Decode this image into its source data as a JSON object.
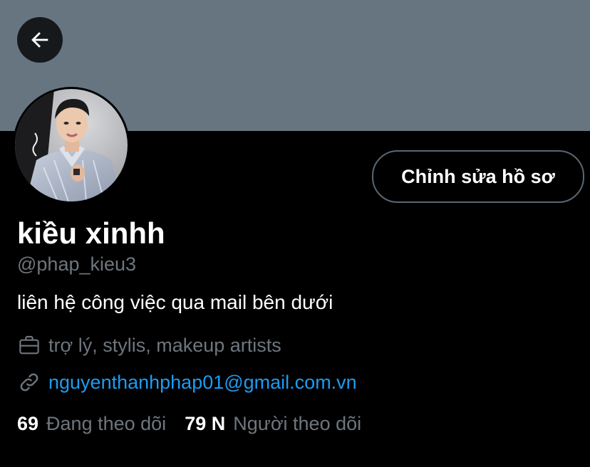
{
  "header": {
    "back_icon": "arrow-left-icon"
  },
  "profile": {
    "display_name": "kiều xinhh",
    "handle": "@phap_kieu3",
    "bio": "liên hệ công việc qua mail bên dưới",
    "category": "trợ lý, stylis, makeup artists",
    "category_icon": "briefcase-icon",
    "link": "nguyenthanhphap01@gmail.com.vn",
    "link_icon": "link-icon"
  },
  "actions": {
    "edit_label": "Chỉnh sửa hồ sơ"
  },
  "stats": {
    "following_count": "69",
    "following_label": "Đang theo dõi",
    "followers_count": "79 N",
    "followers_label": "Người theo dõi"
  },
  "colors": {
    "banner": "#66757f",
    "background": "#000000",
    "link": "#1d9bf0",
    "secondary_text": "#6e767d"
  }
}
